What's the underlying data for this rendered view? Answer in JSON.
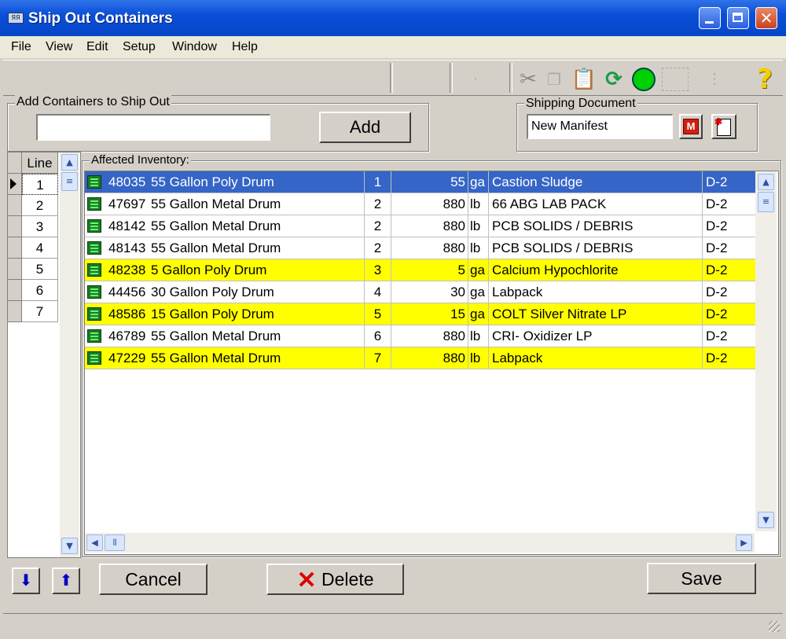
{
  "window": {
    "title": "Ship Out Containers",
    "icon_text": "ЯЯ"
  },
  "menu": [
    "File",
    "View",
    "Edit",
    "Setup",
    "Window",
    "Help"
  ],
  "toolbar": {
    "help_glyph": "?"
  },
  "add_section": {
    "label": "Add Containers to Ship Out",
    "input_value": "",
    "add_button": "Add"
  },
  "shipping": {
    "label": "Shipping Document",
    "value": "New Manifest",
    "manifest_button": "M"
  },
  "line_grid": {
    "header": "Line",
    "lines": [
      "1",
      "2",
      "3",
      "4",
      "5",
      "6",
      "7"
    ]
  },
  "inventory": {
    "label": "Affected Inventory:",
    "rows": [
      {
        "id": "48035",
        "container": "55 Gallon Poly Drum",
        "line": "1",
        "qty": "55",
        "unit": "ga",
        "desc": "Castion Sludge",
        "code": "D-2",
        "style": "sel"
      },
      {
        "id": "47697",
        "container": "55 Gallon Metal Drum",
        "line": "2",
        "qty": "880",
        "unit": "lb",
        "desc": "66 ABG LAB PACK",
        "code": "D-2",
        "style": ""
      },
      {
        "id": "48142",
        "container": "55 Gallon Metal Drum",
        "line": "2",
        "qty": "880",
        "unit": "lb",
        "desc": "PCB SOLIDS / DEBRIS",
        "code": "D-2",
        "style": ""
      },
      {
        "id": "48143",
        "container": "55 Gallon Metal Drum",
        "line": "2",
        "qty": "880",
        "unit": "lb",
        "desc": "PCB SOLIDS / DEBRIS",
        "code": "D-2",
        "style": ""
      },
      {
        "id": "48238",
        "container": "5 Gallon Poly Drum",
        "line": "3",
        "qty": "5",
        "unit": "ga",
        "desc": "Calcium Hypochlorite",
        "code": "D-2",
        "style": "yellow"
      },
      {
        "id": "44456",
        "container": "30 Gallon Poly Drum",
        "line": "4",
        "qty": "30",
        "unit": "ga",
        "desc": "Labpack",
        "code": "D-2",
        "style": ""
      },
      {
        "id": "48586",
        "container": "15 Gallon Poly Drum",
        "line": "5",
        "qty": "15",
        "unit": "ga",
        "desc": "COLT Silver Nitrate LP",
        "code": "D-2",
        "style": "yellow"
      },
      {
        "id": "46789",
        "container": "55 Gallon Metal Drum",
        "line": "6",
        "qty": "880",
        "unit": "lb",
        "desc": "CRI- Oxidizer LP",
        "code": "D-2",
        "style": ""
      },
      {
        "id": "47229",
        "container": "55 Gallon Metal Drum",
        "line": "7",
        "qty": "880",
        "unit": "lb",
        "desc": "Labpack",
        "code": "D-2",
        "style": "yellow"
      }
    ]
  },
  "buttons": {
    "cancel": "Cancel",
    "delete": "Delete",
    "save": "Save"
  },
  "colors": {
    "selection": "#3565c7",
    "highlight": "#ffff00",
    "titlebar": "#0a4fd8"
  }
}
